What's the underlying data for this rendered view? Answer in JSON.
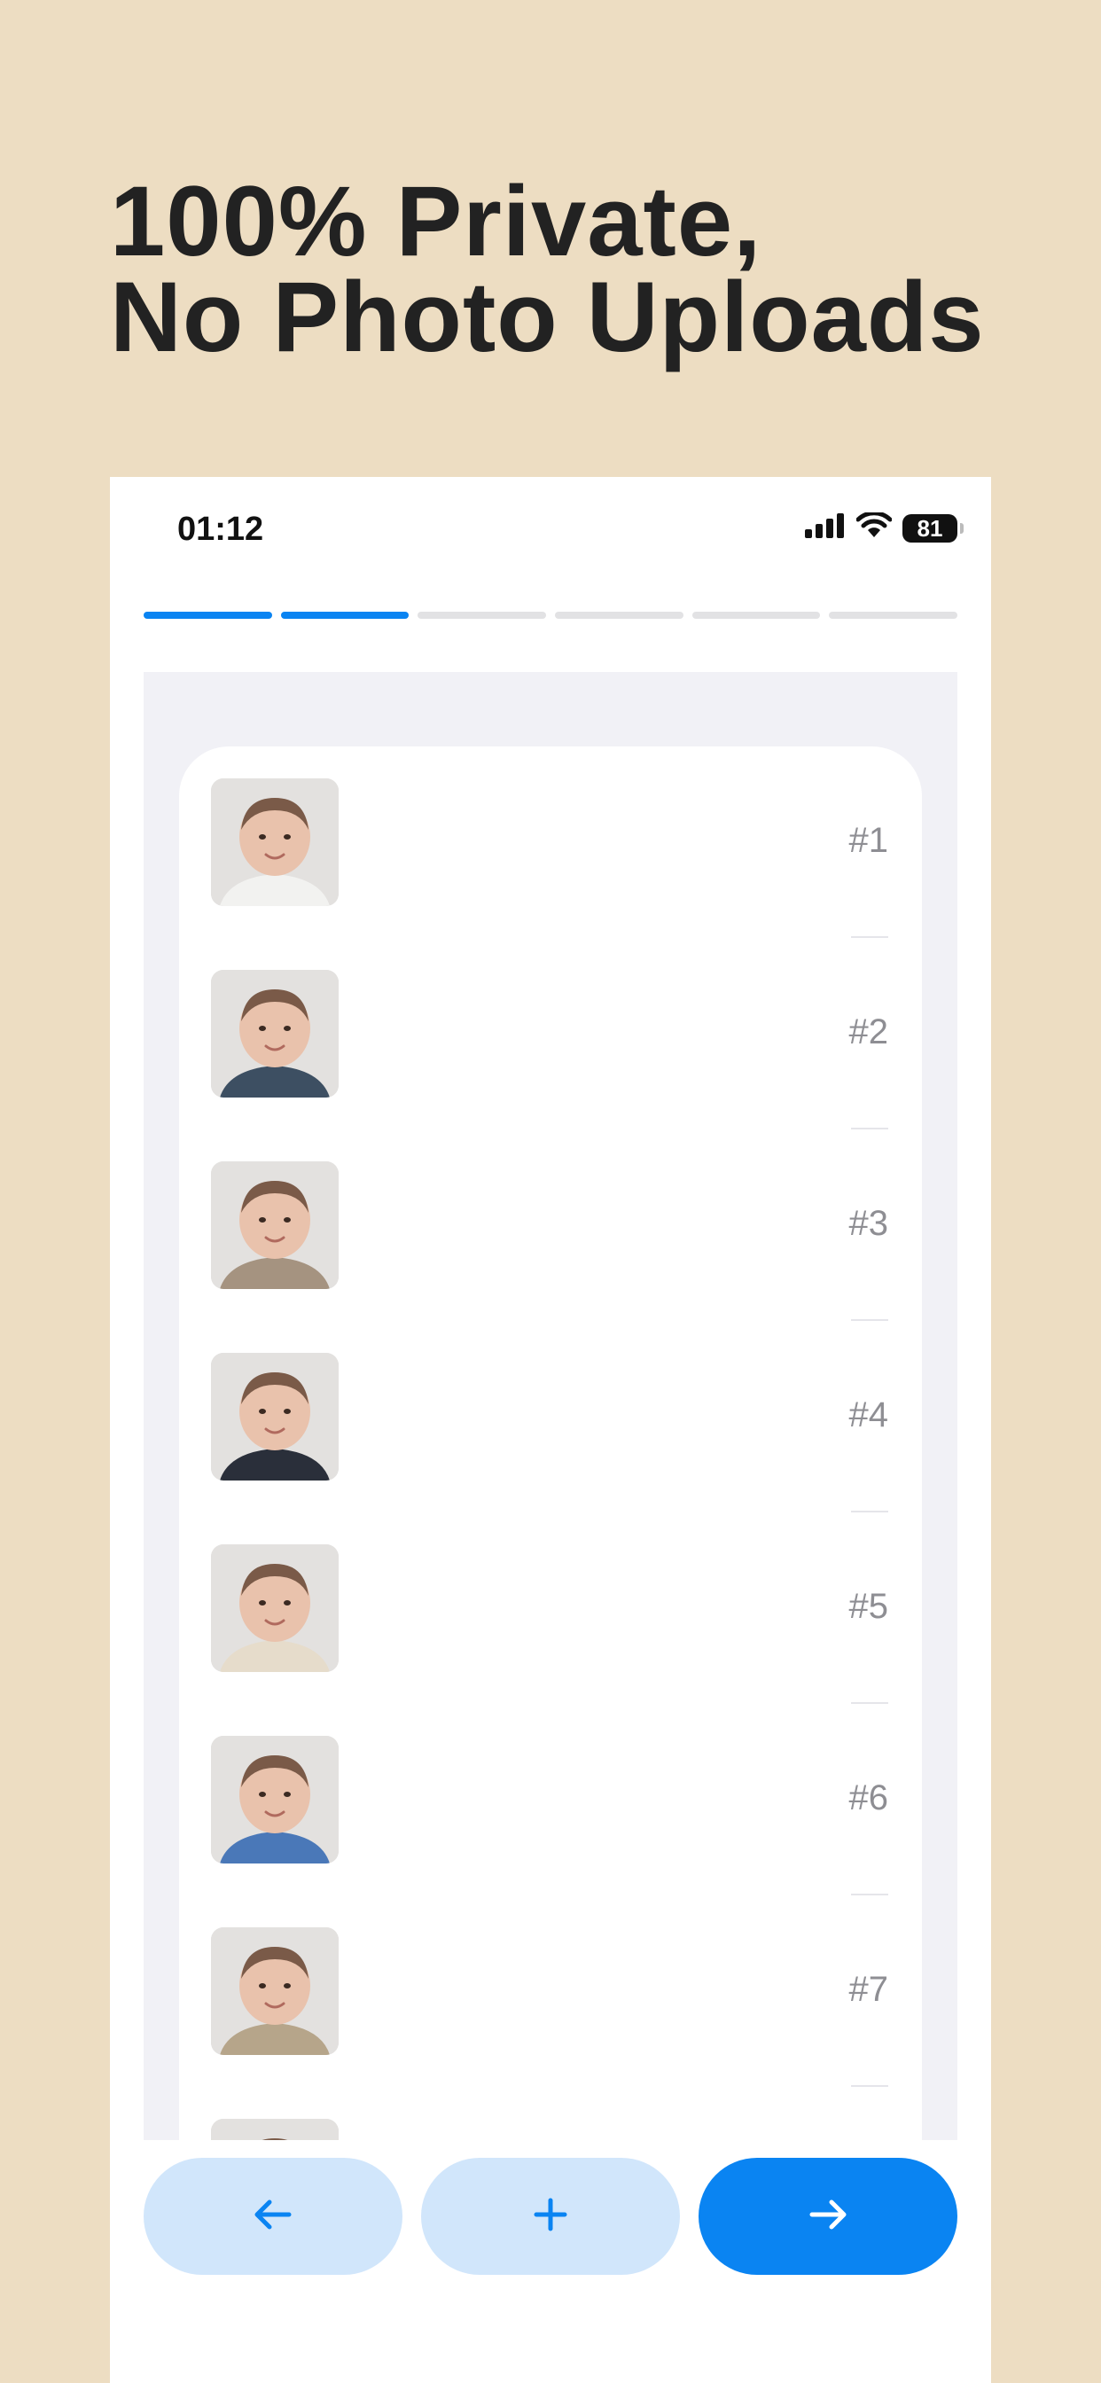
{
  "promo": {
    "headline_line1": "100% Private,",
    "headline_line2": "No Photo Uploads"
  },
  "status_bar": {
    "time": "01:12",
    "battery": "81",
    "icons": [
      "signal-icon",
      "wifi-icon",
      "battery-icon"
    ]
  },
  "progress": {
    "total_steps": 6,
    "completed_steps": 2
  },
  "photo_list": {
    "items": [
      {
        "label": "#1",
        "thumb": "baby-photo"
      },
      {
        "label": "#2",
        "thumb": "baby-photo"
      },
      {
        "label": "#3",
        "thumb": "baby-photo"
      },
      {
        "label": "#4",
        "thumb": "baby-photo"
      },
      {
        "label": "#5",
        "thumb": "baby-photo"
      },
      {
        "label": "#6",
        "thumb": "baby-photo"
      },
      {
        "label": "#7",
        "thumb": "baby-photo"
      }
    ]
  },
  "buttons": {
    "back_icon": "arrow-left-icon",
    "add_icon": "plus-icon",
    "next_icon": "arrow-right-icon"
  },
  "colors": {
    "background": "#EDDDC2",
    "accent": "#0A84F2",
    "accent_light": "#D1E6FB",
    "headline": "#222222"
  }
}
